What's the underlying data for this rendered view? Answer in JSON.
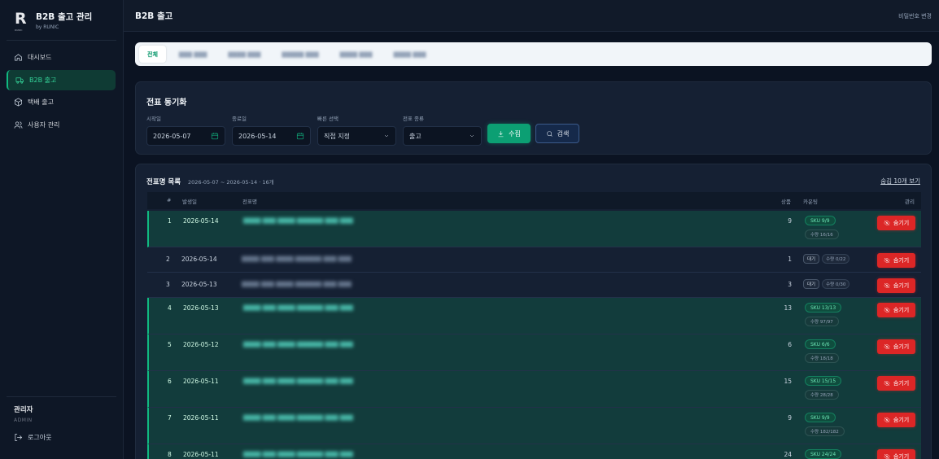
{
  "brand": {
    "logo_letter": "R",
    "logo_sub": "RUNIC",
    "title": "B2B 출고 관리",
    "by": "by RUNIC"
  },
  "nav": [
    {
      "label": "대시보드",
      "icon": "home-icon"
    },
    {
      "label": "B2B 출고",
      "icon": "truck-icon",
      "active": true
    },
    {
      "label": "택배 출고",
      "icon": "box-icon"
    },
    {
      "label": "사용자 관리",
      "icon": "users-icon"
    }
  ],
  "user": {
    "name": "관리자",
    "role": "ADMIN",
    "logout": "로그아웃"
  },
  "header": {
    "title": "B2B 출고",
    "password_change": "비밀번호 변경"
  },
  "tabs": [
    {
      "label": "전체",
      "active": true
    }
  ],
  "sync": {
    "title": "전표 동기화",
    "start_label": "시작일",
    "start_value": "2026-05-07",
    "end_label": "종료일",
    "end_value": "2026-05-14",
    "quick_label": "빠른 선택",
    "quick_value": "직접 지정",
    "type_label": "전표 종류",
    "type_value": "출고",
    "collect_button": "수집",
    "search_button": "검색"
  },
  "list": {
    "title": "전표명 목록",
    "meta": "2026-05-07 ~ 2026-05-14 · 16개",
    "hide_recent": "숨김 10개 보기",
    "columns": {
      "num": "#",
      "date": "발생일",
      "name": "전표명",
      "goods": "상품",
      "status": "카운팅",
      "manage": "관리"
    },
    "hide_button": "숨기기",
    "rows": [
      {
        "num": "1",
        "date": "2026-05-14",
        "goods": "9",
        "synced": true,
        "sku": "SKU  9/9",
        "qty": "수량  16/16"
      },
      {
        "num": "2",
        "date": "2026-05-14",
        "goods": "1",
        "synced": false,
        "wait": "대기",
        "qty": "수량 0/22"
      },
      {
        "num": "3",
        "date": "2026-05-13",
        "goods": "3",
        "synced": false,
        "wait": "대기",
        "qty": "수량 0/30"
      },
      {
        "num": "4",
        "date": "2026-05-13",
        "goods": "13",
        "synced": true,
        "sku": "SKU  13/13",
        "qty": "수량  97/97"
      },
      {
        "num": "5",
        "date": "2026-05-12",
        "goods": "6",
        "synced": true,
        "sku": "SKU  6/6",
        "qty": "수량  18/18"
      },
      {
        "num": "6",
        "date": "2026-05-11",
        "goods": "15",
        "synced": true,
        "sku": "SKU  15/15",
        "qty": "수량  28/28"
      },
      {
        "num": "7",
        "date": "2026-05-11",
        "goods": "9",
        "synced": true,
        "sku": "SKU  9/9",
        "qty": "수량  182/182"
      },
      {
        "num": "8",
        "date": "2026-05-11",
        "goods": "24",
        "synced": true,
        "sku": "SKU  24/24",
        "qty": ""
      }
    ]
  },
  "colors": {
    "accent": "#10b981",
    "danger": "#dc2626",
    "bg": "#0b1322"
  }
}
